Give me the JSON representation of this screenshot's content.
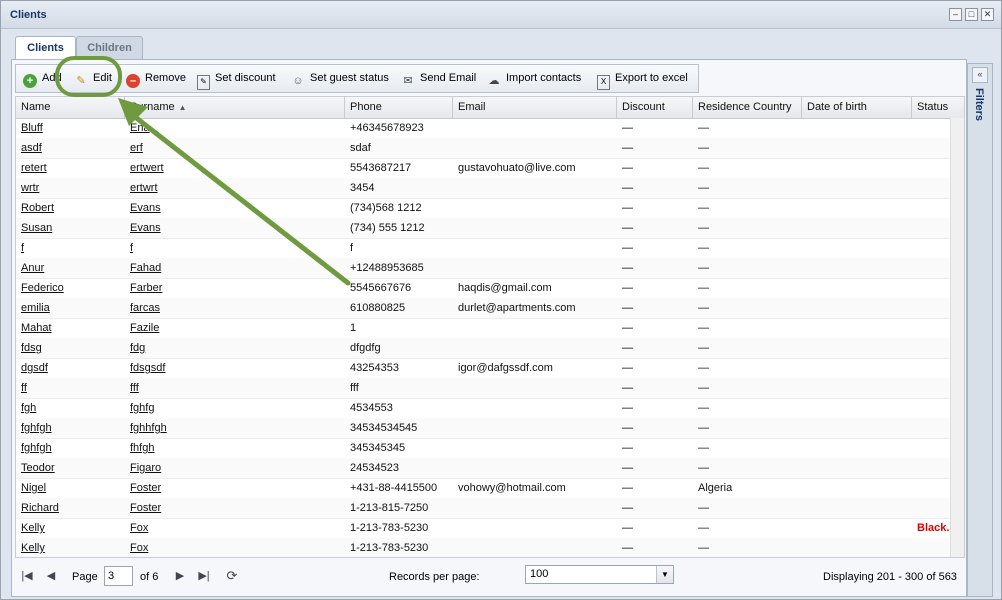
{
  "window": {
    "title": "Clients"
  },
  "tabs": [
    {
      "label": "Clients"
    },
    {
      "label": "Children"
    }
  ],
  "toolbar": {
    "add": "Add",
    "edit": "Edit",
    "remove": "Remove",
    "set_discount": "Set discount",
    "set_guest_status": "Set guest status",
    "send_email": "Send Email",
    "import_contacts": "Import contacts",
    "export_excel": "Export to excel"
  },
  "grid": {
    "columns": [
      "Name",
      "Surname",
      "Phone",
      "Email",
      "Discount",
      "Residence Country",
      "Date of birth",
      "Status"
    ],
    "rows": [
      {
        "name": "Bluff",
        "surname": "Ena",
        "phone": "+46345678923",
        "email": "",
        "discount": "—",
        "country": "—",
        "dob": "",
        "status": ""
      },
      {
        "name": "asdf",
        "surname": "erf",
        "phone": "sdaf",
        "email": "",
        "discount": "—",
        "country": "—",
        "dob": "",
        "status": ""
      },
      {
        "name": "retert",
        "surname": "ertwert",
        "phone": "5543687217",
        "email": "gustavohuato@live.com",
        "discount": "—",
        "country": "—",
        "dob": "",
        "status": ""
      },
      {
        "name": "wrtr",
        "surname": "ertwrt",
        "phone": "3454",
        "email": "",
        "discount": "—",
        "country": "—",
        "dob": "",
        "status": ""
      },
      {
        "name": "Robert",
        "surname": "Evans",
        "phone": "(734)568 1212",
        "email": "",
        "discount": "—",
        "country": "—",
        "dob": "",
        "status": ""
      },
      {
        "name": "Susan",
        "surname": "Evans",
        "phone": "(734) 555 1212",
        "email": "",
        "discount": "—",
        "country": "—",
        "dob": "",
        "status": ""
      },
      {
        "name": "f",
        "surname": "f",
        "phone": "f",
        "email": "",
        "discount": "—",
        "country": "—",
        "dob": "",
        "status": ""
      },
      {
        "name": "Anur",
        "surname": "Fahad",
        "phone": "+12488953685",
        "email": "",
        "discount": "—",
        "country": "—",
        "dob": "",
        "status": ""
      },
      {
        "name": "Federico",
        "surname": "Farber",
        "phone": "5545667676",
        "email": "haqdis@gmail.com",
        "discount": "—",
        "country": "—",
        "dob": "",
        "status": ""
      },
      {
        "name": "emilia",
        "surname": "farcas",
        "phone": "610880825",
        "email": "durlet@apartments.com",
        "discount": "—",
        "country": "—",
        "dob": "",
        "status": ""
      },
      {
        "name": "Mahat",
        "surname": "Fazile",
        "phone": "1",
        "email": "",
        "discount": "—",
        "country": "—",
        "dob": "",
        "status": ""
      },
      {
        "name": "fdsg",
        "surname": "fdg",
        "phone": "dfgdfg",
        "email": "",
        "discount": "—",
        "country": "—",
        "dob": "",
        "status": ""
      },
      {
        "name": "dgsdf",
        "surname": "fdsgsdf",
        "phone": "43254353",
        "email": "igor@dafgssdf.com",
        "discount": "—",
        "country": "—",
        "dob": "",
        "status": ""
      },
      {
        "name": "ff",
        "surname": "fff",
        "phone": "fff",
        "email": "",
        "discount": "—",
        "country": "—",
        "dob": "",
        "status": ""
      },
      {
        "name": "fgh",
        "surname": "fghfg",
        "phone": "4534553",
        "email": "",
        "discount": "—",
        "country": "—",
        "dob": "",
        "status": ""
      },
      {
        "name": "fghfgh",
        "surname": "fghhfgh",
        "phone": "34534534545",
        "email": "",
        "discount": "—",
        "country": "—",
        "dob": "",
        "status": ""
      },
      {
        "name": "fghfgh",
        "surname": "fhfgh",
        "phone": "345345345",
        "email": "",
        "discount": "—",
        "country": "—",
        "dob": "",
        "status": ""
      },
      {
        "name": "Teodor",
        "surname": "Figaro",
        "phone": "24534523",
        "email": "",
        "discount": "—",
        "country": "—",
        "dob": "",
        "status": ""
      },
      {
        "name": "Nigel",
        "surname": "Foster",
        "phone": "+431-88-4415500",
        "email": "vohowy@hotmail.com",
        "discount": "—",
        "country": "Algeria",
        "dob": "",
        "status": ""
      },
      {
        "name": "Richard",
        "surname": "Foster",
        "phone": "1-213-815-7250",
        "email": "",
        "discount": "—",
        "country": "—",
        "dob": "",
        "status": ""
      },
      {
        "name": "Kelly",
        "surname": "Fox",
        "phone": "1-213-783-5230",
        "email": "",
        "discount": "—",
        "country": "—",
        "dob": "",
        "status": "Black..."
      },
      {
        "name": "Kelly",
        "surname": "Fox",
        "phone": "1-213-783-5230",
        "email": "",
        "discount": "—",
        "country": "—",
        "dob": "",
        "status": ""
      }
    ]
  },
  "pager": {
    "page_label": "Page",
    "current_page": "3",
    "of_pages": "of 6",
    "records_label": "Records per page:",
    "records_per_page": "100",
    "display_text": "Displaying 201 - 300 of 563"
  },
  "filters_panel": {
    "label": "Filters"
  },
  "colors": {
    "highlight": "#6f9a3f",
    "status_red": "#e00000",
    "title_blue": "#15376b"
  }
}
